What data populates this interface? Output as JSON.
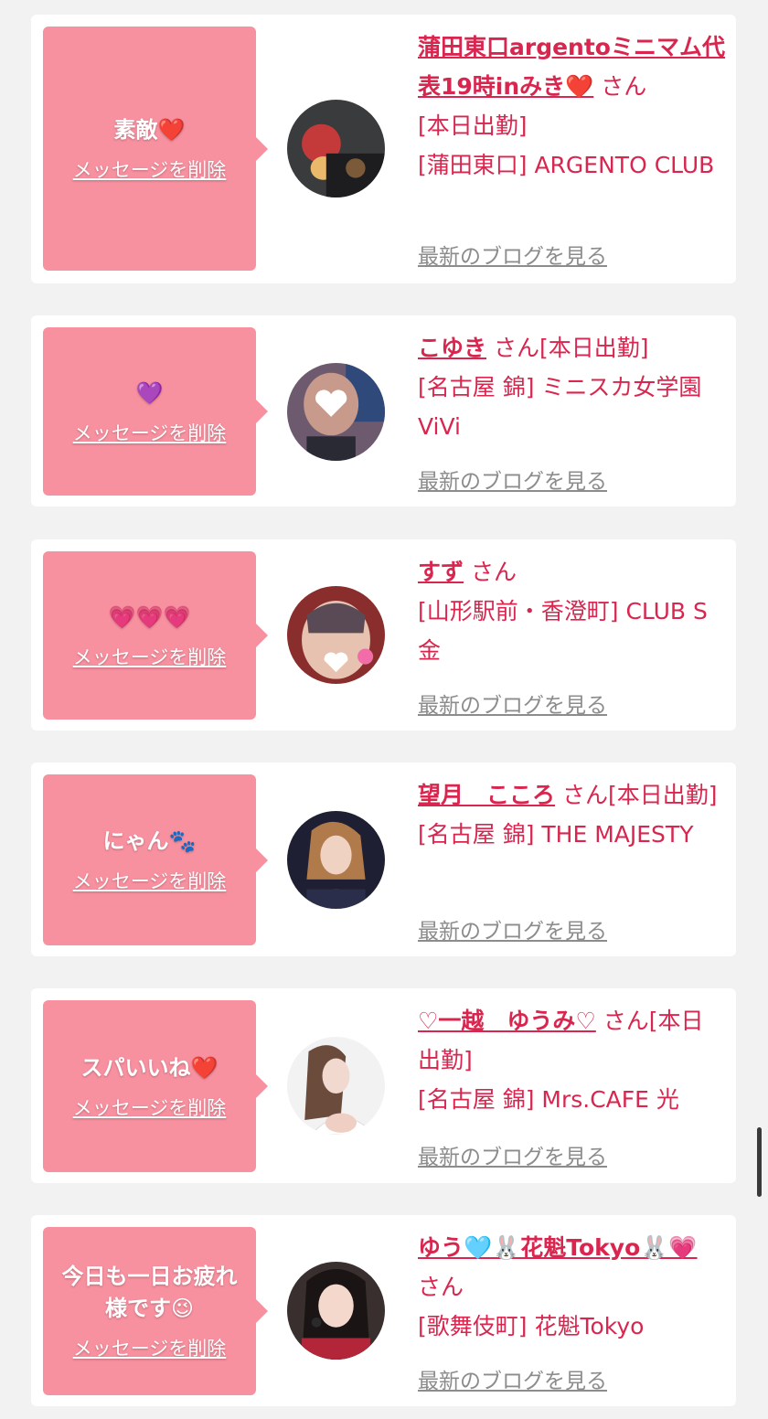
{
  "delete_label": "メッセージを削除",
  "blog_label": "最新のブログを見る",
  "san_label": "さん",
  "colors": {
    "accent": "#d9264f",
    "bubble": "#f7909f",
    "link_gray": "#8c8c8c",
    "background": "#f2f2f2"
  },
  "messages": [
    {
      "message": "素敵❤️",
      "name": "蒲田東口argentoミニマム代表19時inみき❤️",
      "suffix": "さん",
      "status": "[本日出勤]",
      "shop": "[蒲田東口] ARGENTO CLUB"
    },
    {
      "message": "💜",
      "name": "こゆき",
      "suffix": "さん[本日出勤]",
      "status": "",
      "shop": "[名古屋 錦] ミニスカ女学園ViVi"
    },
    {
      "message": "💗💗💗",
      "name": "すず",
      "suffix": "さん",
      "status": "",
      "shop": "[山形駅前・香澄町] CLUB S金"
    },
    {
      "message": "にゃん🐾",
      "name": "望月　こころ",
      "suffix": "さん[本日出勤]",
      "status": "",
      "shop": "[名古屋 錦] THE MAJESTY"
    },
    {
      "message": "スパいいね❤️",
      "name": "♡一越　ゆうみ♡",
      "suffix": "さん[本日出勤]",
      "status": "",
      "shop": "[名古屋 錦] Mrs.CAFE 光"
    },
    {
      "message": "今日も一日お疲れ様です😉",
      "name": "ゆう🩵🐰花魁Tokyo🐰💗",
      "suffix": "さん",
      "status": "",
      "shop": "[歌舞伎町] 花魁Tokyo"
    }
  ]
}
